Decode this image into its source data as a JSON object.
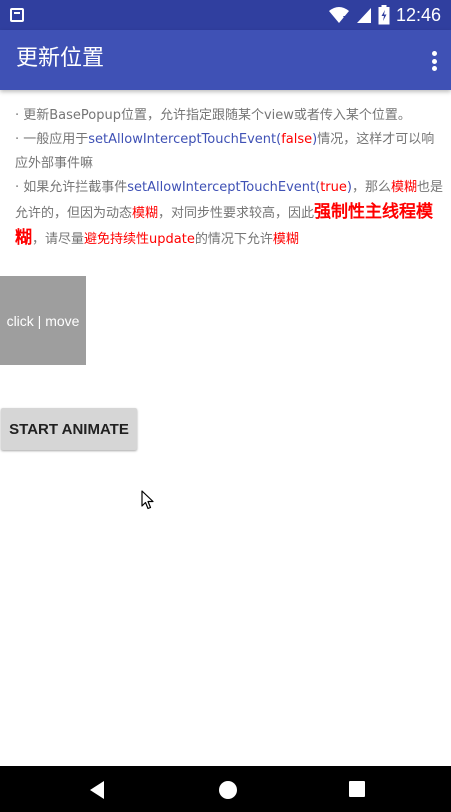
{
  "status_bar": {
    "time": "12:46",
    "icons": [
      "sim-card-icon",
      "wifi-icon",
      "signal-icon",
      "battery-icon"
    ]
  },
  "app_bar": {
    "title": "更新位置",
    "more_icon": "more-vert-icon"
  },
  "description": {
    "line1": {
      "text": "· 更新BasePopup位置，允许指定跟随某个view或者传入某个位置。"
    },
    "line2": {
      "prefix": "· 一般应用于",
      "method": "setAllowInterceptTouchEvent(",
      "arg": "false",
      "suffix_close": ")",
      "suffix": "情况，这样才可以响应外部事件嘛"
    },
    "line3": {
      "prefix": "· 如果允许拦截事件",
      "method": "setAllowInterceptTouchEvent(",
      "arg": "true",
      "close": ")",
      "t1": "，那么",
      "blur1": "模糊",
      "t2": "也是允许的，但因为动态",
      "blur2": "模糊",
      "t3": "，对同步性要求较高，因此",
      "emphasis": "强制性主线程模糊",
      "t4": "，请尽量",
      "avoid": "避免持续性update",
      "t5": "的情况下允许",
      "blur3": "模糊"
    }
  },
  "drag_box": {
    "label": "click | move"
  },
  "animate_button": {
    "label": "START ANIMATE"
  },
  "nav_bar": {
    "icons": [
      "back-icon",
      "home-icon",
      "recent-apps-icon"
    ]
  },
  "colors": {
    "status_bar": "#303F9F",
    "app_bar": "#3F51B5",
    "link_blue": "#3F51B5",
    "accent_red": "#FF0000",
    "drag_box": "#9E9E9E",
    "button": "#D6D6D6"
  }
}
